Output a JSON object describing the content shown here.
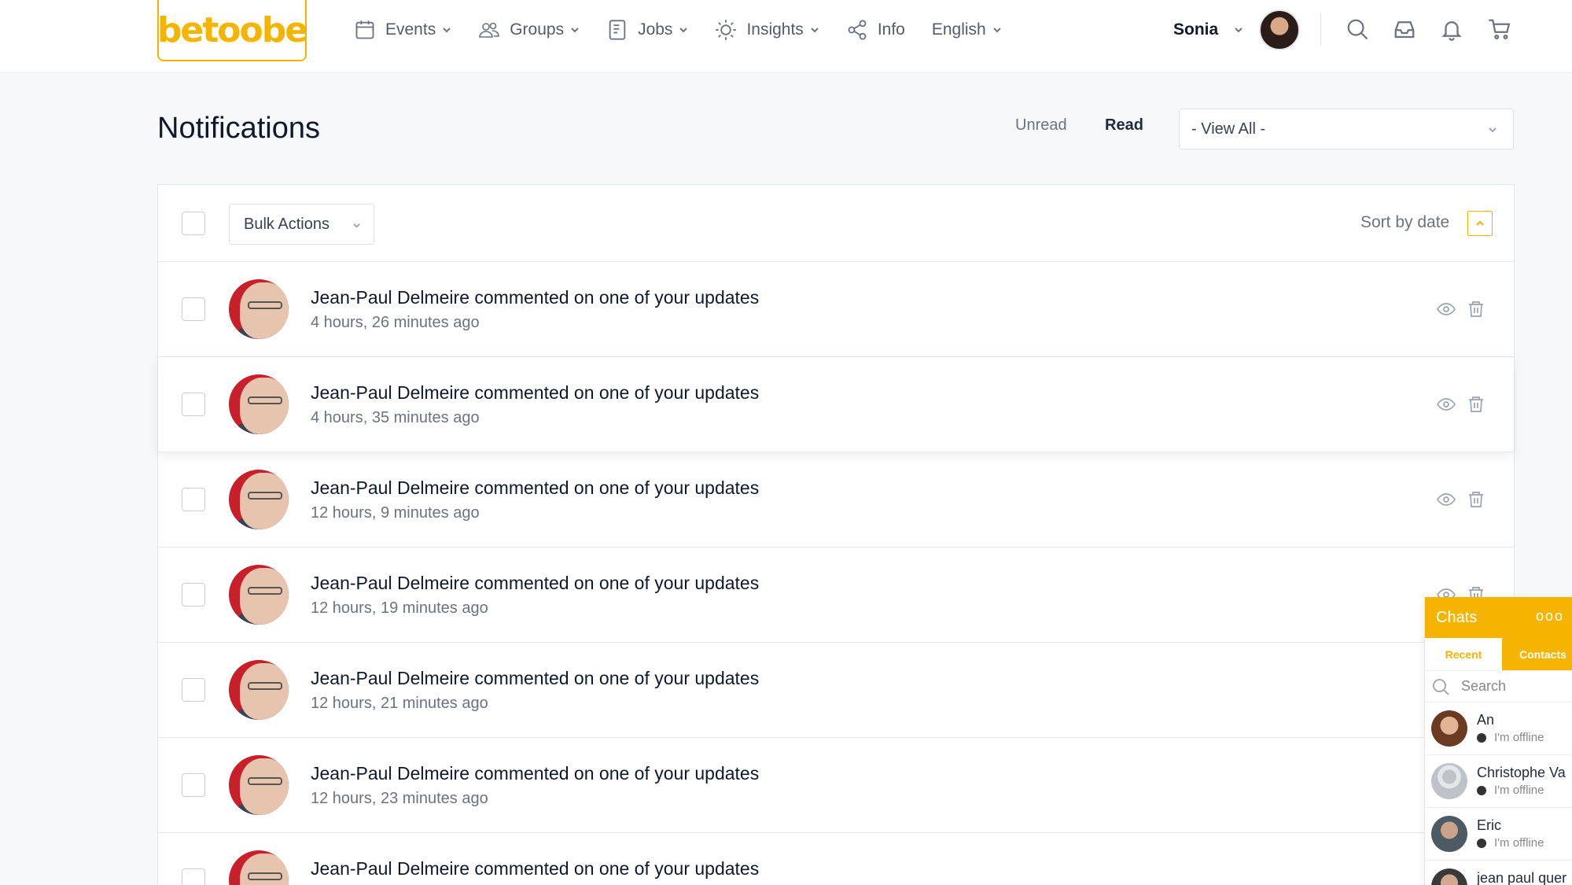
{
  "header": {
    "logo_text": "betoobe",
    "nav": [
      {
        "label": "Events",
        "icon": "calendar-icon"
      },
      {
        "label": "Groups",
        "icon": "users-icon"
      },
      {
        "label": "Jobs",
        "icon": "document-icon"
      },
      {
        "label": "Insights",
        "icon": "sun-icon"
      },
      {
        "label": "Info",
        "icon": "share-icon"
      },
      {
        "label": "English",
        "icon": ""
      }
    ],
    "user_name": "Sonia",
    "icons": [
      "search-icon",
      "inbox-icon",
      "bell-icon",
      "cart-icon"
    ]
  },
  "page": {
    "title": "Notifications",
    "filter_unread": "Unread",
    "filter_read": "Read",
    "view_select": "- View All -"
  },
  "toolbar": {
    "bulk_actions": "Bulk Actions",
    "sort_label": "Sort by date"
  },
  "notifications": [
    {
      "text": "Jean-Paul Delmeire commented on one of your updates",
      "time": "4 hours, 26 minutes ago"
    },
    {
      "text": "Jean-Paul Delmeire commented on one of your updates",
      "time": "4 hours, 35 minutes ago"
    },
    {
      "text": "Jean-Paul Delmeire commented on one of your updates",
      "time": "12 hours, 9 minutes ago"
    },
    {
      "text": "Jean-Paul Delmeire commented on one of your updates",
      "time": "12 hours, 19 minutes ago"
    },
    {
      "text": "Jean-Paul Delmeire commented on one of your updates",
      "time": "12 hours, 21 minutes ago"
    },
    {
      "text": "Jean-Paul Delmeire commented on one of your updates",
      "time": "12 hours, 23 minutes ago"
    },
    {
      "text": "Jean-Paul Delmeire commented on one of your updates",
      "time": ""
    }
  ],
  "chat": {
    "title": "Chats",
    "more": "ooo",
    "tab_recent": "Recent",
    "tab_contacts": "Contacts",
    "search_placeholder": "Search",
    "contacts": [
      {
        "name": "An",
        "status": "I'm offline"
      },
      {
        "name": "Christophe Va",
        "status": "I'm offline"
      },
      {
        "name": "Eric",
        "status": "I'm offline"
      },
      {
        "name": "jean paul quer",
        "status": ""
      }
    ]
  },
  "colors": {
    "accent": "#f5b400",
    "text_dark": "#0e1a2b",
    "text_muted": "#6b7280"
  }
}
